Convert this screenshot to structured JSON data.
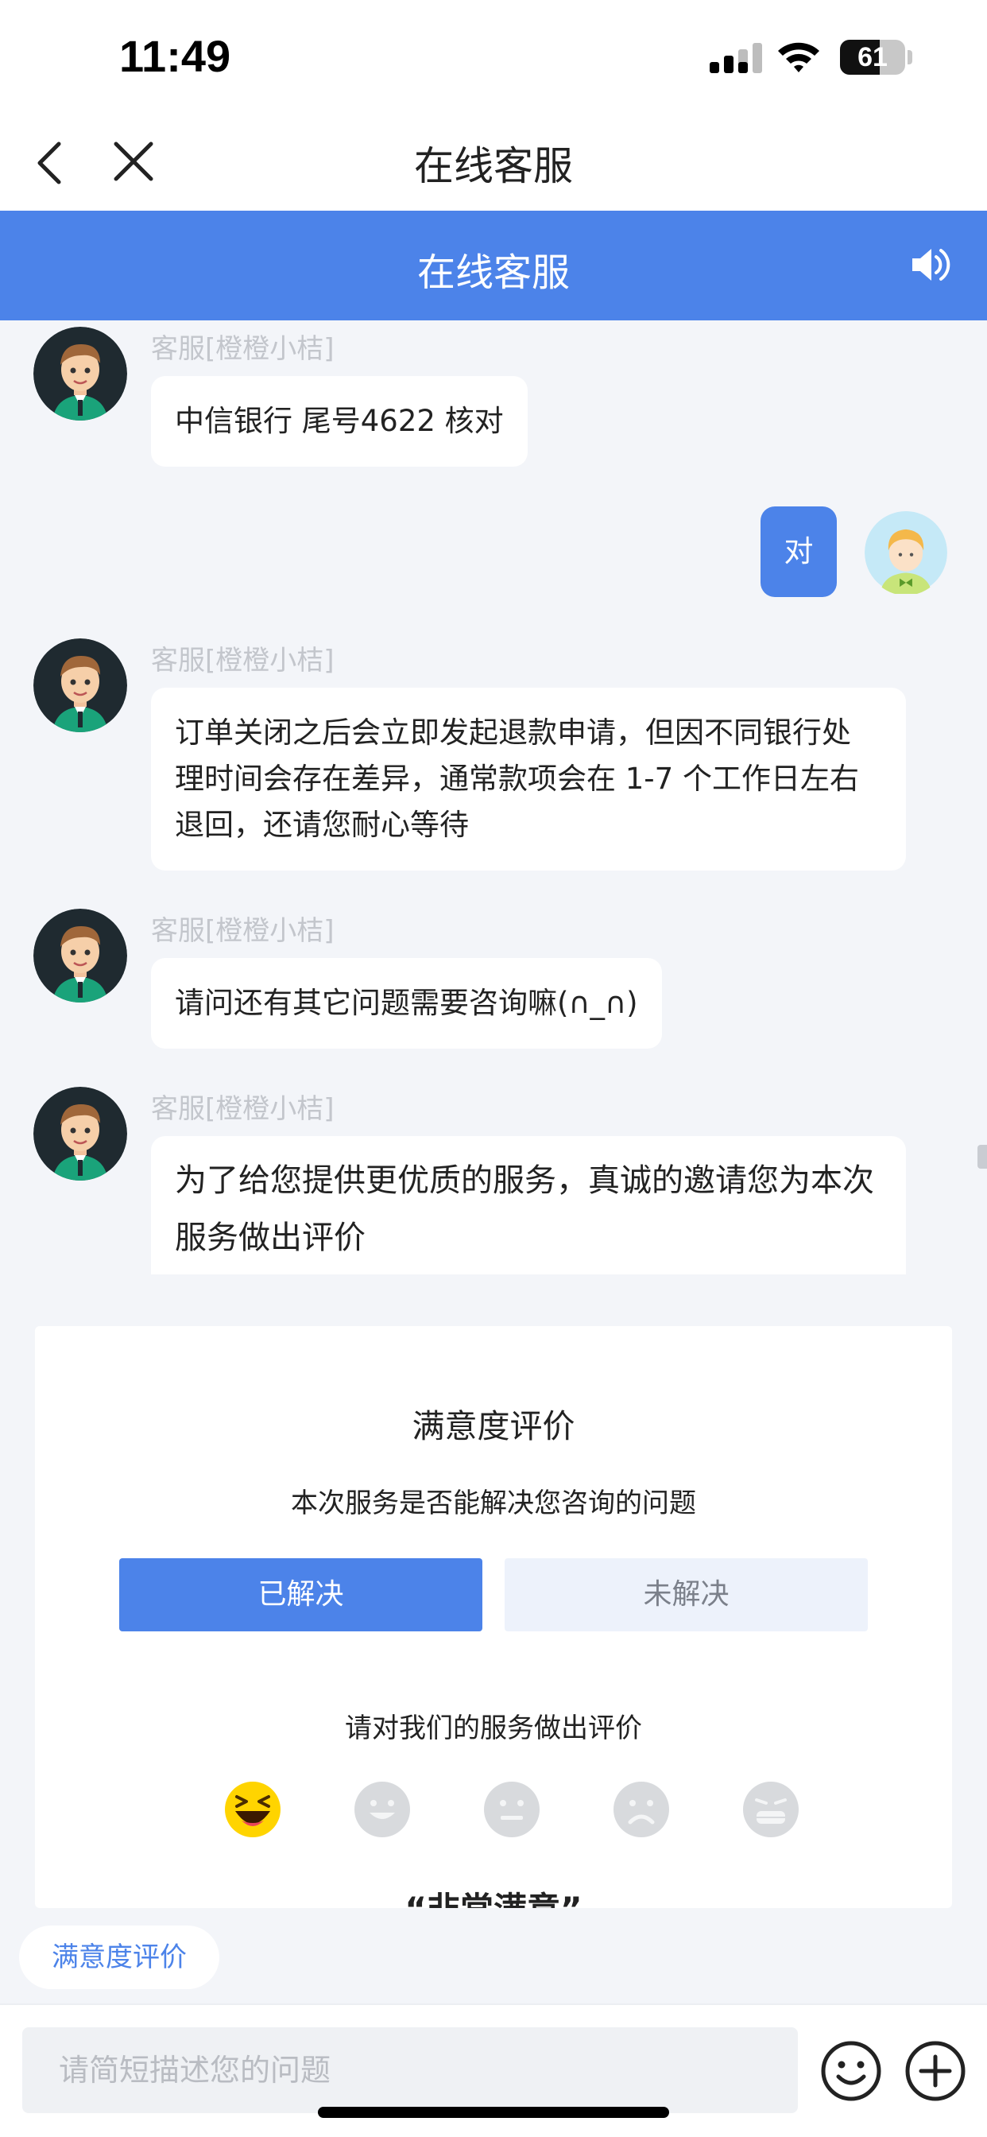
{
  "status_bar": {
    "time": "11:49",
    "battery_level": "61",
    "battery_fraction": 0.61
  },
  "nav": {
    "title": "在线客服"
  },
  "chat_header": {
    "title": "在线客服"
  },
  "messages": [
    {
      "role": "agent",
      "sender": "客服[橙橙小桔]",
      "text": "中信银行  尾号4622  核对"
    },
    {
      "role": "user",
      "text": "对"
    },
    {
      "role": "agent",
      "sender": "客服[橙橙小桔]",
      "lines": [
        "订单关闭之后会立即发起退款申请，但因不同银行处",
        "理时间会存在差异，通常款项会在 1-7 个工作日左右",
        "退回，还请您耐心等待"
      ]
    },
    {
      "role": "agent",
      "sender": "客服[橙橙小桔]",
      "text": "请问还有其它问题需要咨询嘛(∩_∩)"
    },
    {
      "role": "agent",
      "sender": "客服[橙橙小桔]",
      "lines": [
        "为了给您提供更优质的服务，真诚的邀请您为本次",
        "服务做出评价"
      ]
    }
  ],
  "rating": {
    "title": "满意度评价",
    "question": "本次服务是否能解决您咨询的问题",
    "resolved_label": "已解决",
    "unresolved_label": "未解决",
    "prompt": "请对我们的服务做出评价",
    "faces": [
      "very-satisfied-face-icon",
      "satisfied-face-icon",
      "neutral-face-icon",
      "unsatisfied-face-icon",
      "very-unsatisfied-face-icon"
    ],
    "selected_face": 0,
    "result": "“非常满意”"
  },
  "quick_reply": {
    "label": "满意度评价"
  },
  "input": {
    "placeholder": "请简短描述您的问题"
  },
  "colors": {
    "accent": "#4c83e9",
    "background": "#f3f5f9",
    "selected_face": "#ffd400"
  }
}
